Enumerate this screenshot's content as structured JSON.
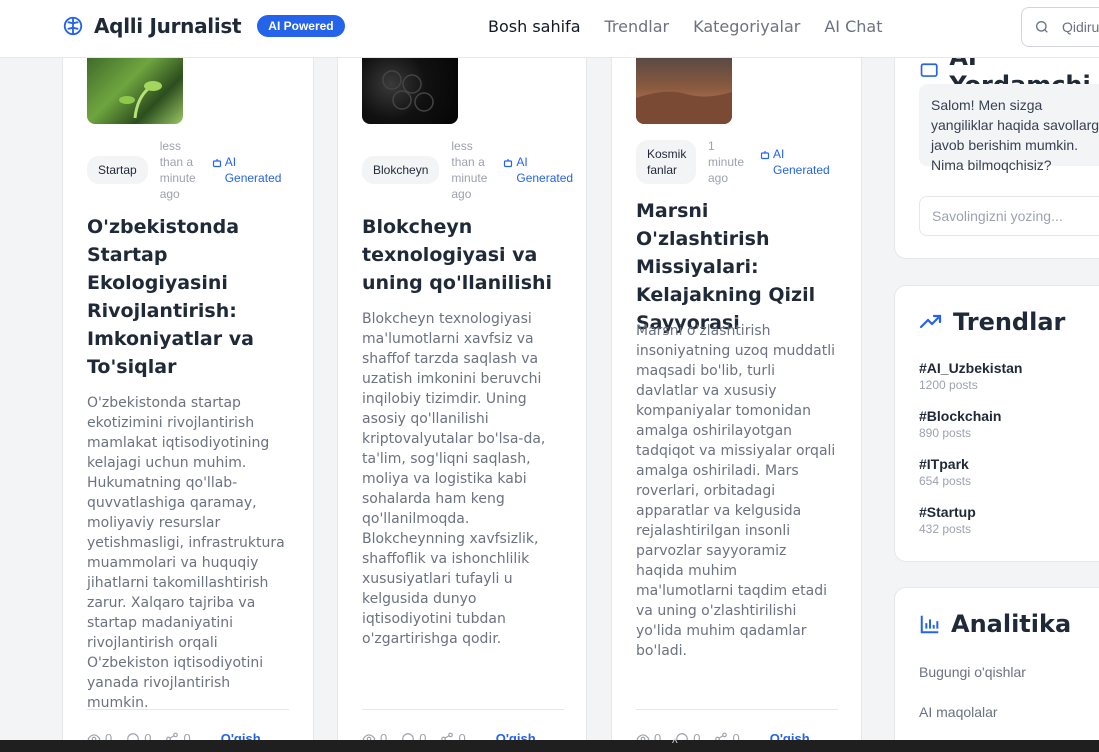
{
  "header": {
    "brand": "Aqlli Jurnalist",
    "badge": "AI Powered",
    "nav": [
      "Bosh sahifa",
      "Trendlar",
      "Kategoriyalar",
      "AI Chat"
    ],
    "search_placeholder": "Qidiru"
  },
  "articles": [
    {
      "category": "Startap",
      "time": "less than a minute ago",
      "ai_label": "AI Generated",
      "title": "O'zbekistonda Startap Ekologiyasini Rivojlantirish: Imkoniyatlar va To'siqlar",
      "excerpt": "O'zbekistonda startap ekotizimini rivojlantirish mamlakat iqtisodiyotining kelajagi uchun muhim. Hukumatning qo'llab-quvvatlashiga qaramay, moliyaviy resurslar yetishmasligi, infrastruktura muammolari va huquqiy jihatlarni takomillashtirish zarur. Xalqaro tajriba va startap madaniyatini rivojlantirish orqali O'zbekiston iqtisodiyotini yanada rivojlantirish mumkin.",
      "views": "0",
      "comments": "0",
      "shares": "0",
      "read": "O'qish"
    },
    {
      "category": "Blokcheyn",
      "time": "less than a minute ago",
      "ai_label": "AI Generated",
      "title": "Blokcheyn texnologiyasi va uning qo'llanilishi",
      "excerpt": "Blokcheyn texnologiyasi ma'lumotlarni xavfsiz va shaffof tarzda saqlash va uzatish imkonini beruvchi inqilobiy tizimdir. Uning asosiy qo'llanilishi kriptovalyutalar bo'lsa-da, ta'lim, sog'liqni saqlash, moliya va logistika kabi sohalarda ham keng qo'llanilmoqda. Blokcheynning xavfsizlik, shaffoflik va ishonchlilik xususiyatlari tufayli u kelgusida dunyo iqtisodiyotini tubdan o'zgartirishga qodir.",
      "views": "0",
      "comments": "0",
      "shares": "0",
      "read": "O'qish"
    },
    {
      "category": "Kosmik fanlar",
      "time": "1 minute ago",
      "ai_label": "AI Generated",
      "title": "Marsni O'zlashtirish Missiyalari: Kelajakning Qizil Sayyorasi",
      "excerpt": "Marsni o'zlashtirish insoniyatning uzoq muddatli maqsadi bo'lib, turli davlatlar va xususiy kompaniyalar tomonidan amalga oshirilayotgan tadqiqot va missiyalar orqali amalga oshiriladi. Mars roverlari, orbitadagi apparatlar va kelgusida rejalashtirilgan insonli parvozlar sayyoramiz haqida muhim ma'lumotlarni taqdim etadi va uning o'zlashtirilishi yo'lida muhim qadamlar bo'ladi.",
      "views": "0",
      "comments": "0",
      "shares": "0",
      "read": "O'qish"
    }
  ],
  "sidebar": {
    "assistant": {
      "title": "AI Yordamchi",
      "message": "Salom! Men sizga yangiliklar haqida savollarga javob berishim mumkin. Nima bilmoqchisiz?",
      "input_placeholder": "Savolingizni yozing..."
    },
    "trends": {
      "title": "Trendlar",
      "items": [
        {
          "tag": "#AI_Uzbekistan",
          "count": "1200 posts"
        },
        {
          "tag": "#Blockchain",
          "count": "890 posts"
        },
        {
          "tag": "#ITpark",
          "count": "654 posts"
        },
        {
          "tag": "#Startup",
          "count": "432 posts"
        }
      ]
    },
    "analytics": {
      "title": "Analitika",
      "rows": [
        "Bugungi o'qishlar",
        "AI maqolalar"
      ]
    }
  },
  "colors": {
    "accent": "#2563eb",
    "text": "#1f2937",
    "muted": "#6b7280",
    "bg": "#f3f4f6"
  }
}
